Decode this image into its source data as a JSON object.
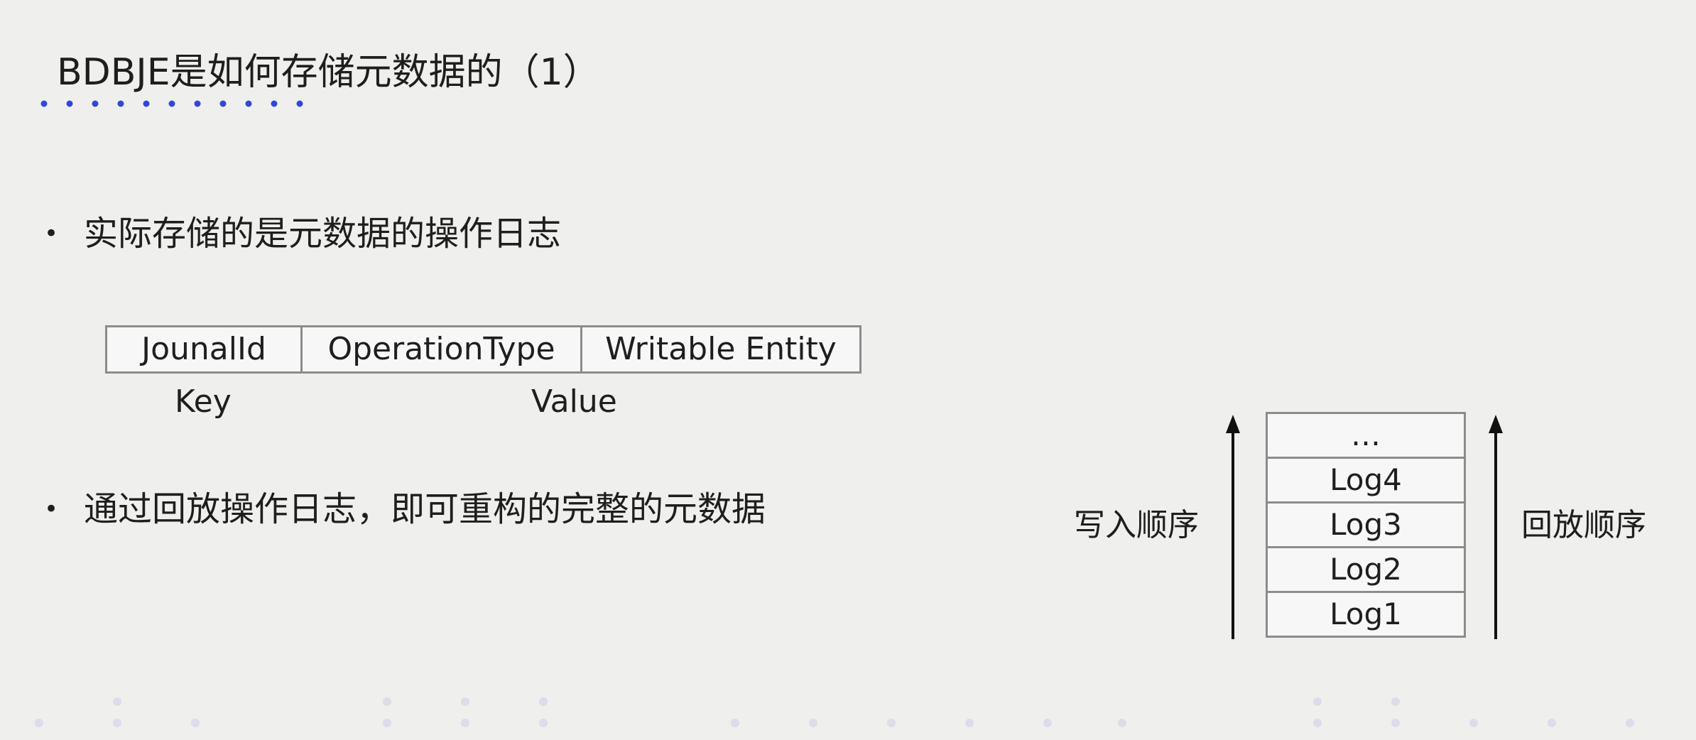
{
  "slide": {
    "title": "BDBJE是如何存储元数据的（1）",
    "accent_color": "#2f49d1",
    "bullets": [
      {
        "marker": "•",
        "text": "实际存储的是元数据的操作日志"
      },
      {
        "marker": "•",
        "text": "通过回放操作日志，即可重构的完整的元数据"
      }
    ],
    "record_table": {
      "cells": [
        "JounalId",
        "OperationType",
        "Writable Entity"
      ],
      "key_label": "Key",
      "value_label": "Value"
    },
    "log_stack": {
      "items": [
        "…",
        "Log4",
        "Log3",
        "Log2",
        "Log1"
      ],
      "write_order_label": "写入顺序",
      "replay_order_label": "回放顺序"
    }
  }
}
